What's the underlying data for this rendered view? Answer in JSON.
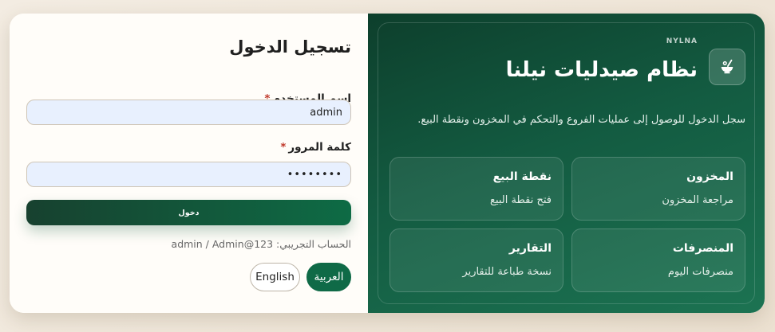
{
  "login": {
    "title": "تسجيل الدخول",
    "username_label": "اسم المستخدم",
    "username_value": "admin",
    "password_label": "كلمة المرور",
    "password_value": "••••••••",
    "required_mark": "*",
    "submit_label": "دخول",
    "demo_hint": "الحساب التجريبي: admin / Admin@123",
    "languages": [
      {
        "label": "العربية",
        "active": true
      },
      {
        "label": "English",
        "active": false
      }
    ]
  },
  "brand": {
    "tag": "NYLNA",
    "title": "نظام صيدليات نيلنا",
    "description": "سجل الدخول للوصول إلى عمليات الفروع والتحكم في المخزون ونقطة البيع.",
    "logo_icon": "pharmacy-logo-icon",
    "tiles": [
      {
        "title": "المخزون",
        "subtitle": "مراجعة المخزون"
      },
      {
        "title": "نقطة البيع",
        "subtitle": "فتح نقطة البيع"
      },
      {
        "title": "المنصرفات",
        "subtitle": "منصرفات اليوم"
      },
      {
        "title": "التقارير",
        "subtitle": "نسخة طباعة للتقارير"
      }
    ]
  },
  "colors": {
    "primary": "#0f6a47",
    "panel_dark": "#0d3f2c",
    "input_bg": "#e8f0fe",
    "required": "#c0392b"
  }
}
